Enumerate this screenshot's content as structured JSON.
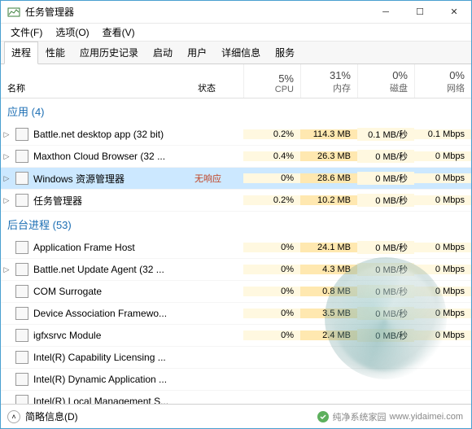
{
  "window": {
    "title": "任务管理器"
  },
  "menu": {
    "file": "文件(F)",
    "options": "选项(O)",
    "view": "查看(V)"
  },
  "tabs": {
    "processes": "进程",
    "performance": "性能",
    "apphistory": "应用历史记录",
    "startup": "启动",
    "users": "用户",
    "details": "详细信息",
    "services": "服务"
  },
  "columns": {
    "name": "名称",
    "status": "状态",
    "cpu_pct": "5%",
    "cpu_label": "CPU",
    "mem_pct": "31%",
    "mem_label": "内存",
    "disk_pct": "0%",
    "disk_label": "磁盘",
    "net_pct": "0%",
    "net_label": "网络"
  },
  "groups": {
    "apps": {
      "label": "应用 (4)"
    },
    "background": {
      "label": "后台进程 (53)"
    }
  },
  "status_text": {
    "not_responding": "无响应"
  },
  "apps": [
    {
      "name": "Battle.net desktop app (32 bit)",
      "status": "",
      "cpu": "0.2%",
      "mem": "114.3 MB",
      "disk": "0.1 MB/秒",
      "net": "0.1 Mbps",
      "expandable": true
    },
    {
      "name": "Maxthon Cloud Browser (32 ...",
      "status": "",
      "cpu": "0.4%",
      "mem": "26.3 MB",
      "disk": "0 MB/秒",
      "net": "0 Mbps",
      "expandable": true
    },
    {
      "name": "Windows 资源管理器",
      "status": "not_responding",
      "cpu": "0%",
      "mem": "28.6 MB",
      "disk": "0 MB/秒",
      "net": "0 Mbps",
      "expandable": true,
      "selected": true
    },
    {
      "name": "任务管理器",
      "status": "",
      "cpu": "0.2%",
      "mem": "10.2 MB",
      "disk": "0 MB/秒",
      "net": "0 Mbps",
      "expandable": true
    }
  ],
  "background": [
    {
      "name": "Application Frame Host",
      "cpu": "0%",
      "mem": "24.1 MB",
      "disk": "0 MB/秒",
      "net": "0 Mbps"
    },
    {
      "name": "Battle.net Update Agent (32 ...",
      "cpu": "0%",
      "mem": "4.3 MB",
      "disk": "0 MB/秒",
      "net": "0 Mbps",
      "expandable": true
    },
    {
      "name": "COM Surrogate",
      "cpu": "0%",
      "mem": "0.8 MB",
      "disk": "0 MB/秒",
      "net": "0 Mbps"
    },
    {
      "name": "Device Association Framewo...",
      "cpu": "0%",
      "mem": "3.5 MB",
      "disk": "0 MB/秒",
      "net": "0 Mbps"
    },
    {
      "name": "igfxsrvc Module",
      "cpu": "0%",
      "mem": "2.4 MB",
      "disk": "0 MB/秒",
      "net": "0 Mbps"
    },
    {
      "name": "Intel(R) Capability Licensing ...",
      "cpu": "",
      "mem": "",
      "disk": "",
      "net": ""
    },
    {
      "name": "Intel(R) Dynamic Application ...",
      "cpu": "",
      "mem": "",
      "disk": "",
      "net": ""
    },
    {
      "name": "Intel(R) Local Management S...",
      "cpu": "",
      "mem": "",
      "disk": "",
      "net": ""
    }
  ],
  "footer": {
    "simple": "简略信息(D)"
  },
  "watermark": {
    "text": "纯净系统家园",
    "url": "www.yidaimei.com"
  }
}
